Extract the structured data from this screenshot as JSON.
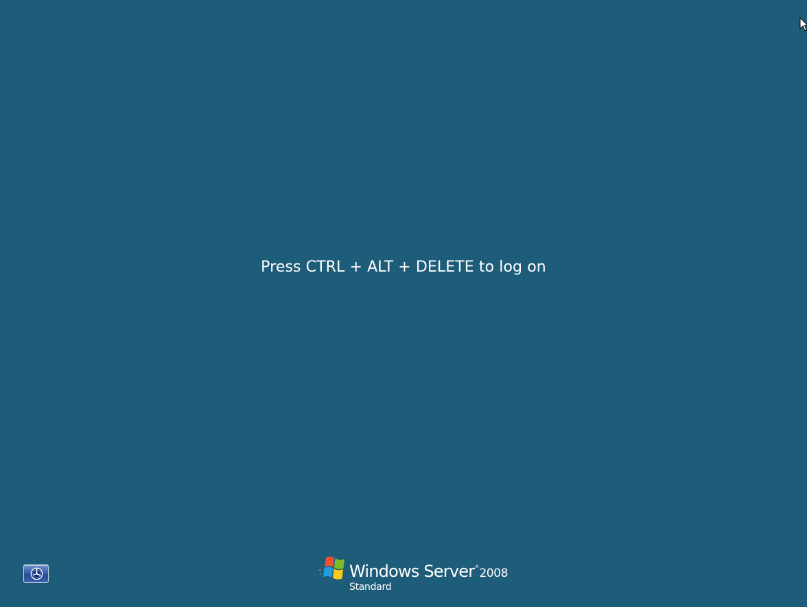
{
  "login": {
    "prompt": "Press CTRL + ALT + DELETE to log on"
  },
  "branding": {
    "product_name": "Windows Server",
    "trademark": "®",
    "version": "2008",
    "edition": "Standard"
  },
  "ease_of_access": {
    "icon": "ease-of-access-icon"
  },
  "colors": {
    "background": "#1e5d79",
    "text": "#ffffff"
  }
}
